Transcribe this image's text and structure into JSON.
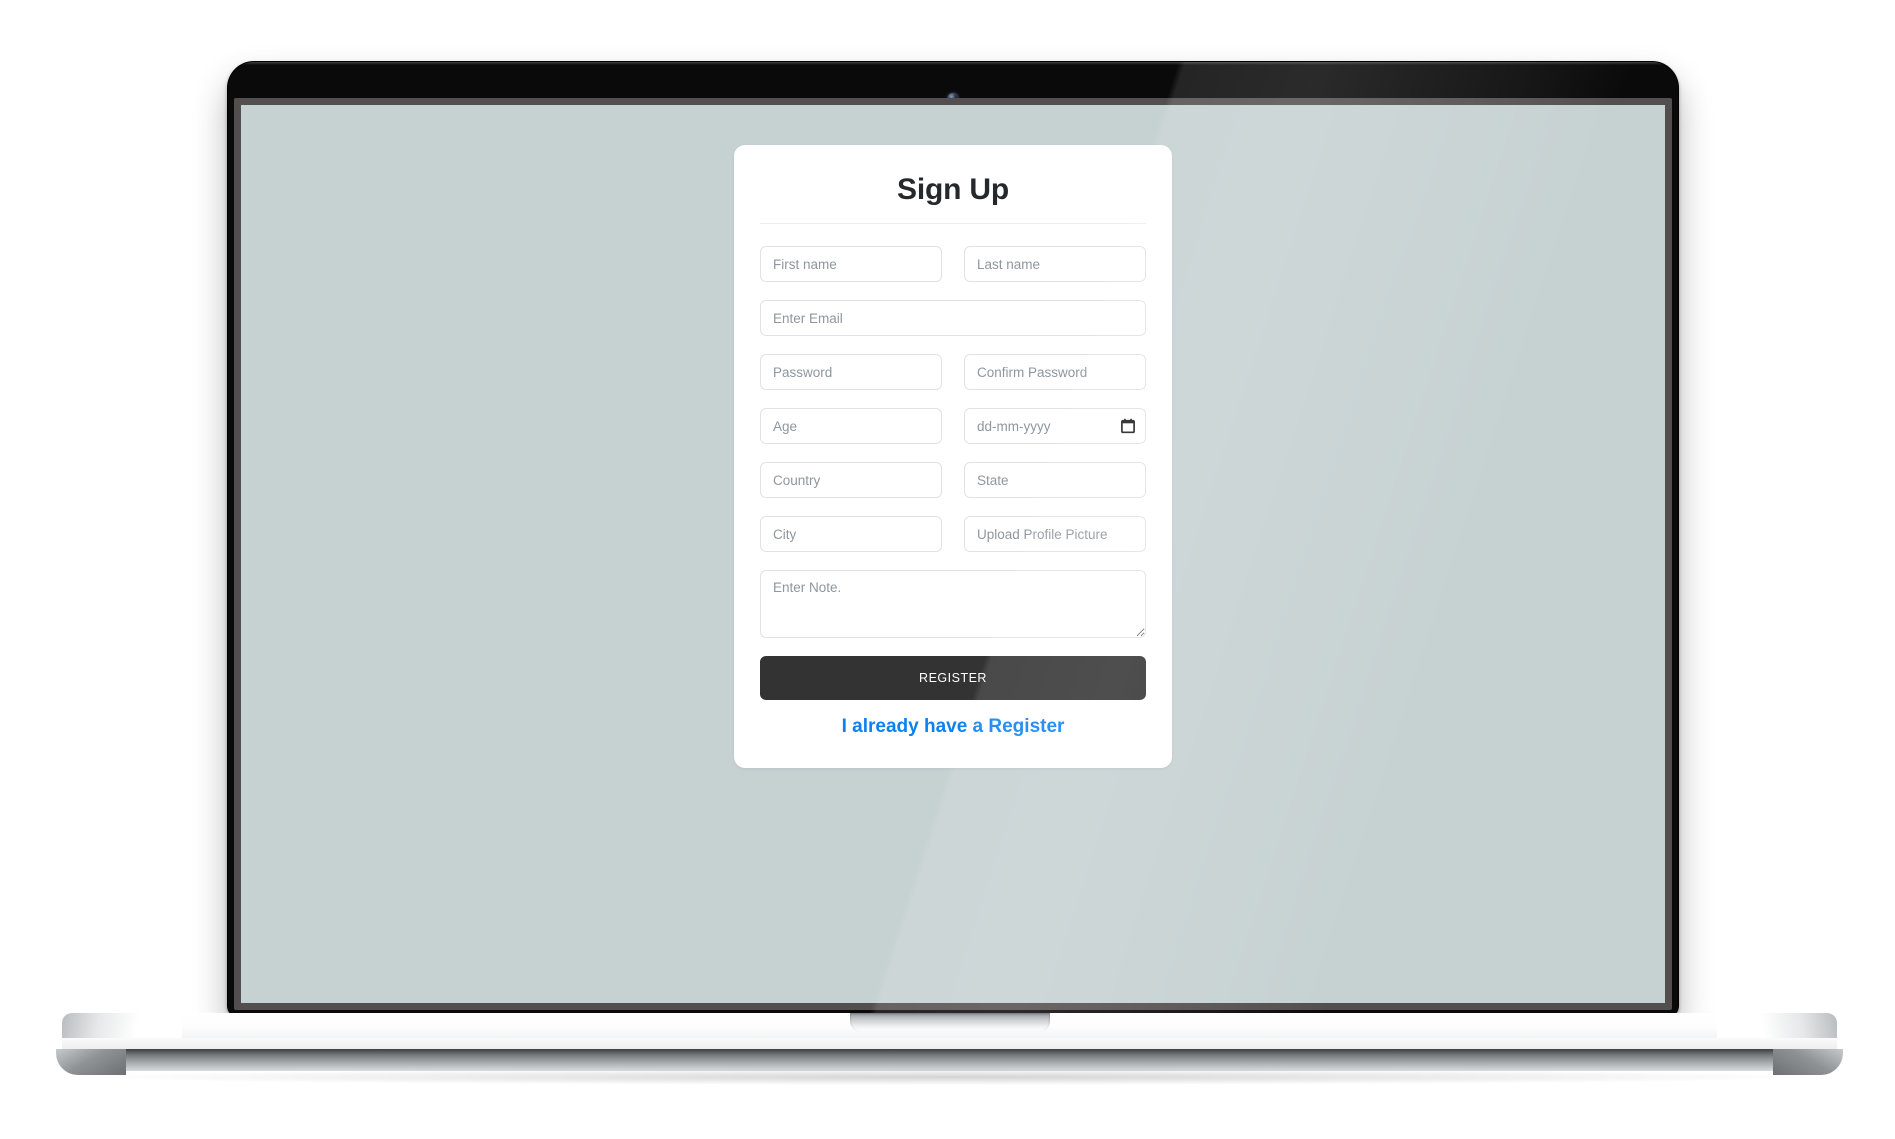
{
  "device": {
    "type": "laptop-mockup",
    "webcam_icon": "camera-dot-icon",
    "screen_background_color": "#c6d1d2",
    "bezel_color": "#0a0a0a",
    "screen_border_color": "#544f4f",
    "base_color": "#ffffff"
  },
  "theme": {
    "card_background": "#ffffff",
    "title_color": "#26292c",
    "input_border": "#dfe3e6",
    "placeholder_color": "#8e979e",
    "button_background": "#333333",
    "button_text_color": "#ffffff",
    "link_color": "#0d80f2"
  },
  "form": {
    "title": "Sign Up",
    "fields": {
      "first_name": {
        "placeholder": "First name",
        "value": ""
      },
      "last_name": {
        "placeholder": "Last name",
        "value": ""
      },
      "email": {
        "placeholder": "Enter Email",
        "value": ""
      },
      "password": {
        "placeholder": "Password",
        "value": ""
      },
      "confirm_password": {
        "placeholder": "Confirm Password",
        "value": ""
      },
      "age": {
        "placeholder": "Age",
        "value": ""
      },
      "dob": {
        "placeholder": "dd-mm-yyyy",
        "value": "",
        "icon": "calendar-icon"
      },
      "country": {
        "placeholder": "Country",
        "value": ""
      },
      "state": {
        "placeholder": "State",
        "value": ""
      },
      "city": {
        "placeholder": "City",
        "value": ""
      },
      "profile_picture": {
        "placeholder": "Upload Profile Picture",
        "value": ""
      },
      "note": {
        "placeholder": "Enter Note.",
        "value": ""
      }
    },
    "submit_label": "REGISTER",
    "login_link_label": "I already have a Register"
  }
}
